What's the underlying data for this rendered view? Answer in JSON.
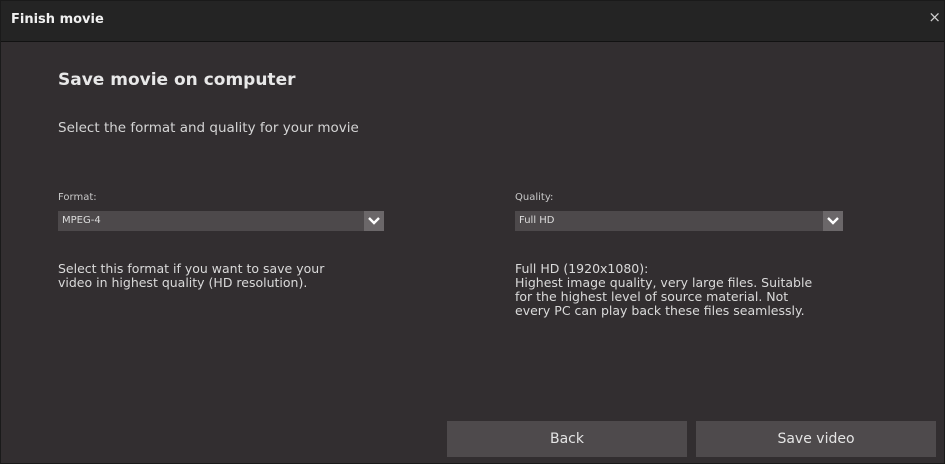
{
  "window": {
    "title": "Finish movie",
    "close_glyph": "×"
  },
  "main": {
    "heading": "Save movie on computer",
    "subheading": "Select the format and quality for your movie"
  },
  "format": {
    "label": "Format:",
    "selected": "MPEG-4",
    "description_lines": [
      "Select this format if you want to save your",
      "video in highest quality (HD resolution)."
    ]
  },
  "quality": {
    "label": "Quality:",
    "selected": "Full HD",
    "description_lines": [
      "Full HD (1920x1080):",
      "Highest image quality, very large files. Suitable",
      "for the highest level of source material. Not",
      "every PC can play back these files seamlessly."
    ]
  },
  "buttons": {
    "back": "Back",
    "save": "Save video"
  },
  "icons": {
    "close": "close-icon",
    "dropdown": "chevron-down-icon"
  },
  "colors": {
    "background": "#322e30",
    "titlebar": "#242424",
    "select_bg": "#4d494b",
    "button_bg": "#4e4a4c"
  }
}
